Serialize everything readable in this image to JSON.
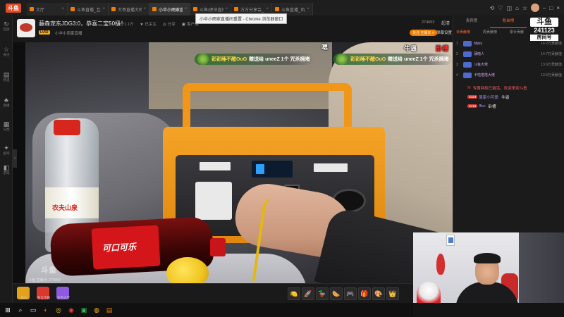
{
  "browser": {
    "brand": "斗鱼",
    "tabs": [
      {
        "title": "大厅"
      },
      {
        "title": "斗鱼直播_互联网直播"
      },
      {
        "title": "大哥直播大师_虎牙直播"
      },
      {
        "title": "小伞小雨家直播间重置"
      },
      {
        "title": "斗鱼/虎牙直播助手"
      },
      {
        "title": "方方分享会_斗鱼直播"
      },
      {
        "title": "斗鱼直播_风暴电竞"
      }
    ],
    "active_tab_index": 3,
    "tooltip": "小伞小雨家直播间重置 - Chrome 浏览器窗口"
  },
  "leftdock": [
    {
      "icon": "↻",
      "label": "回放"
    },
    {
      "icon": "☆",
      "label": "关注"
    },
    {
      "icon": "▤",
      "label": "频道"
    },
    {
      "icon": "♣",
      "label": "直播"
    },
    {
      "icon": "▦",
      "label": "分类"
    },
    {
      "icon": "✦",
      "label": "鱼吧"
    },
    {
      "icon": "◧",
      "label": "游戏"
    }
  ],
  "room": {
    "title": "藤森宠东JDG3:0，恭喜二宝50级！",
    "stats": [
      {
        "icon": "♥",
        "value": "71.1万"
      },
      {
        "icon": "★",
        "value": "已关注"
      },
      {
        "icon": "◎",
        "value": "分享"
      },
      {
        "icon": "▣",
        "value": "客户端"
      }
    ],
    "level": "LV50",
    "sub": "小伞小雨家直播",
    "follow_pill": "关注 主播天 >",
    "follow_count": "26万",
    "hot_number": "274053",
    "quality": "超清",
    "danmu_setting": "弹幕设置"
  },
  "video": {
    "gift_banners": [
      {
        "user": "彭彭睡不醒OuO",
        "text": "赠送给 uneeZ 1个 咒杀拥堵"
      },
      {
        "user": "彭彭睡不醒OuO",
        "text": "赠送给 uneeZ 1个 咒杀拥堵"
      }
    ],
    "danmu": [
      {
        "text": "嗯",
        "color": "#ffffff"
      },
      {
        "text": "牛逼",
        "color": "#ffffff"
      },
      {
        "text": "卧槽",
        "color": "#ff3030"
      }
    ],
    "watermark": "斗鱼",
    "watermark_sub": "斗鱼 直播间: 274053"
  },
  "player_bar": {
    "left_gifts": [
      {
        "label": "鱼丸",
        "color": "#e4a21c"
      },
      {
        "label": "粉丝宝箱",
        "color": "#d9382e"
      },
      {
        "label": "任务大厅",
        "color": "#8e5be0"
      }
    ],
    "tray": [
      "🍋",
      "🚀",
      "🦆",
      "🌭",
      "🎮",
      "🎁",
      "🎨",
      "👑"
    ],
    "more": "›"
  },
  "right_panel": {
    "tabs": [
      {
        "label": "贵宾席"
      },
      {
        "label": "粉丝榜"
      },
      {
        "label": "周星榜"
      }
    ],
    "active_tab": 1,
    "rank_logo": "斗鱼",
    "rank_number": "241123",
    "rank_tag": "房间号",
    "subtabs": [
      {
        "label": "日贡献榜"
      },
      {
        "label": "周贡献榜"
      },
      {
        "label": "累计贡献"
      }
    ],
    "rank_rows": [
      {
        "no": "1",
        "name": "bbjoy",
        "score": "14.2万贡献值"
      },
      {
        "no": "2",
        "name": "蒲暗人",
        "score": "14.7万贡献值"
      },
      {
        "no": "3",
        "name": "斗鱼大佬",
        "score": "13.6万贡献值"
      },
      {
        "no": "4",
        "name": "卡啦搭搭大佬",
        "score": "13.5万贡献值"
      }
    ],
    "chat": [
      {
        "type": "system",
        "badge": "",
        "name": "M",
        "text": "专属特权已激活，欢迎来到斗鱼"
      },
      {
        "type": "user",
        "badge": "LV24",
        "name": "周家小可爱:",
        "text": "牛逼"
      },
      {
        "type": "user",
        "badge": "LV16",
        "name": "ffke:",
        "text": "卧槽"
      }
    ]
  },
  "taskbar": [
    "⊞",
    "⌕",
    "▭",
    "◐",
    "◎",
    "◉",
    "▣",
    "◍",
    "▤"
  ]
}
